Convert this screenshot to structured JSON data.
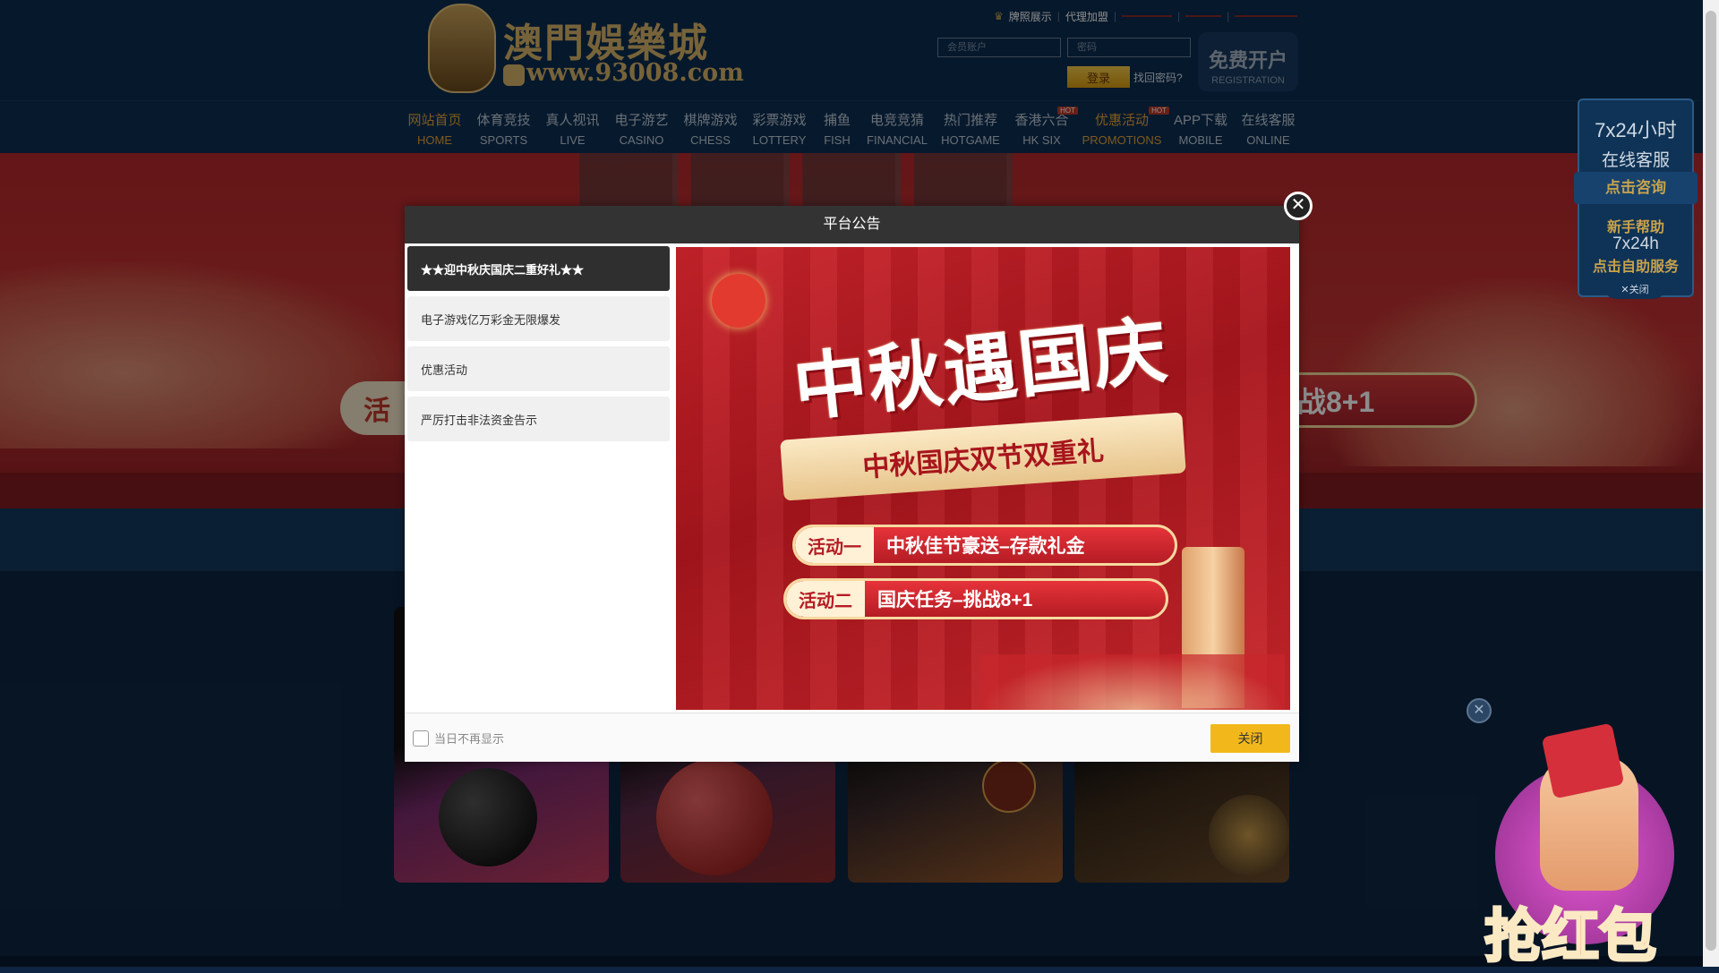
{
  "logo": {
    "title": "澳門娛樂城",
    "url": "www.93008.com"
  },
  "toplinks": {
    "license": "牌照展示",
    "agent": "代理加盟",
    "link3": "",
    "link4": "",
    "link5": ""
  },
  "login": {
    "username_placeholder": "会员账户",
    "password_placeholder": "密码",
    "login_label": "登录",
    "forgot_label": "找回密码?"
  },
  "register": {
    "cn": "免费开户",
    "en": "REGISTRATION"
  },
  "nav": {
    "items": [
      {
        "cn": "网站首页",
        "en": "HOME"
      },
      {
        "cn": "体育竞技",
        "en": "SPORTS"
      },
      {
        "cn": "真人视讯",
        "en": "LIVE"
      },
      {
        "cn": "电子游艺",
        "en": "CASINO"
      },
      {
        "cn": "棋牌游戏",
        "en": "CHESS"
      },
      {
        "cn": "彩票游戏",
        "en": "LOTTERY"
      },
      {
        "cn": "捕鱼",
        "en": "FISH"
      },
      {
        "cn": "电竞竞猜",
        "en": "FINANCIAL"
      },
      {
        "cn": "热门推荐",
        "en": "HOTGAME"
      },
      {
        "cn": "香港六合",
        "en": "HK SIX",
        "badge": "HOT"
      },
      {
        "cn": "优惠活动",
        "en": "PROMOTIONS",
        "badge": "HOT"
      },
      {
        "cn": "APP下载",
        "en": "MOBILE"
      },
      {
        "cn": "在线客服",
        "en": "ONLINE"
      }
    ]
  },
  "banner": {
    "left_pill": "活",
    "right_pill": "战8+1"
  },
  "service_widget": {
    "hours": "7x24小时",
    "online": "在线客服",
    "consult": "点击咨询",
    "newbie": "新手帮助",
    "hours_short": "7x24h",
    "self_service": "点击自助服务",
    "close": "✕关闭"
  },
  "red_packet": {
    "label": "抢红包"
  },
  "modal": {
    "title": "平台公告",
    "notices": [
      "★★迎中秋庆国庆二重好礼★★",
      "电子游戏亿万彩金无限爆发",
      "优惠活动",
      "严厉打击非法资金告示"
    ],
    "active_notice_index": 0,
    "promo": {
      "title": "中秋遇国庆",
      "subtitle": "中秋国庆双节双重礼",
      "activity1_tag": "活动一",
      "activity1_text": "中秋佳节豪送–存款礼金",
      "activity2_tag": "活动二",
      "activity2_text": "国庆任务–挑战8+1"
    },
    "dont_show_label": "当日不再显示",
    "close_label": "关闭"
  },
  "colors": {
    "header_bg": "#0b2d4f",
    "accent_gold": "#e4a53b",
    "modal_close_btn": "#f2b81b",
    "banner_red": "#c53433"
  }
}
